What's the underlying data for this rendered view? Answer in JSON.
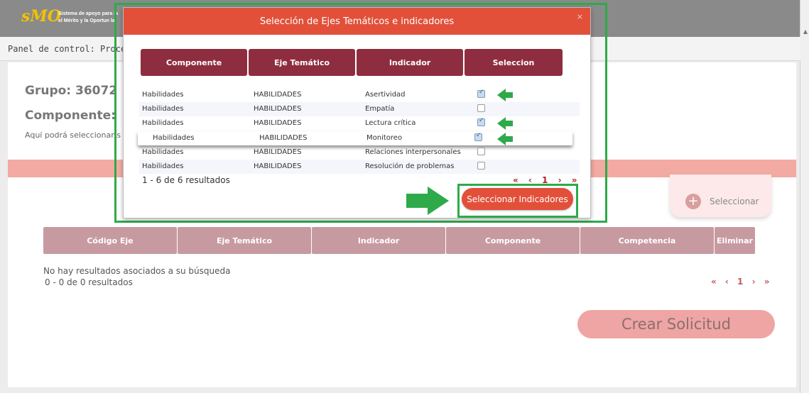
{
  "header": {
    "logo_mark": "sMO",
    "logo_line1": "Sistema de apoyo para la",
    "logo_line2": "el Mérito y la Oportun la"
  },
  "breadcrumb": "Panel de control: Procesos d",
  "page": {
    "grupo": "Grupo: 36072",
    "componente": "Componente:",
    "help_text": "Aquí podrá seleccionar s",
    "seleccionar_label": "Seleccionar",
    "table_headers": [
      "Código Eje",
      "Eje Temático",
      "Indicador",
      "Componente",
      "Competencia",
      "Eliminar"
    ],
    "no_results": "No hay resultados asociados a su búsqueda",
    "results_count": "0 - 0 de 0 resultados",
    "pager": "« ‹ 1 › »",
    "crear_label": "Crear Solicitud"
  },
  "modal": {
    "title": "Selección de Ejes Temáticos e indicadores",
    "close": "×",
    "headers": [
      "Componente",
      "Eje Temático",
      "Indicador",
      "Seleccion"
    ],
    "rows": [
      {
        "componente": "Habilidades",
        "eje": "HABILIDADES",
        "indicador": "Asertividad",
        "checked": true
      },
      {
        "componente": "Habilidades",
        "eje": "HABILIDADES",
        "indicador": "Empatía",
        "checked": false
      },
      {
        "componente": "Habilidades",
        "eje": "HABILIDADES",
        "indicador": "Lectura crítica",
        "checked": true
      },
      {
        "componente": "Habilidades",
        "eje": "HABILIDADES",
        "indicador": "Monitoreo",
        "checked": true
      },
      {
        "componente": "Habilidades",
        "eje": "HABILIDADES",
        "indicador": "Relaciones interpersonales",
        "checked": false
      },
      {
        "componente": "Habilidades",
        "eje": "HABILIDADES",
        "indicador": "Resolución de problemas",
        "checked": false
      }
    ],
    "results_count": "1 - 6 de 6 resultados",
    "pager": "« ‹ 1 › »",
    "select_button": "Seleccionar Indicadores"
  },
  "colors": {
    "modal_header": "#e2503a",
    "table_header": "#8e2d3f",
    "annotation": "#2eaa4a"
  }
}
